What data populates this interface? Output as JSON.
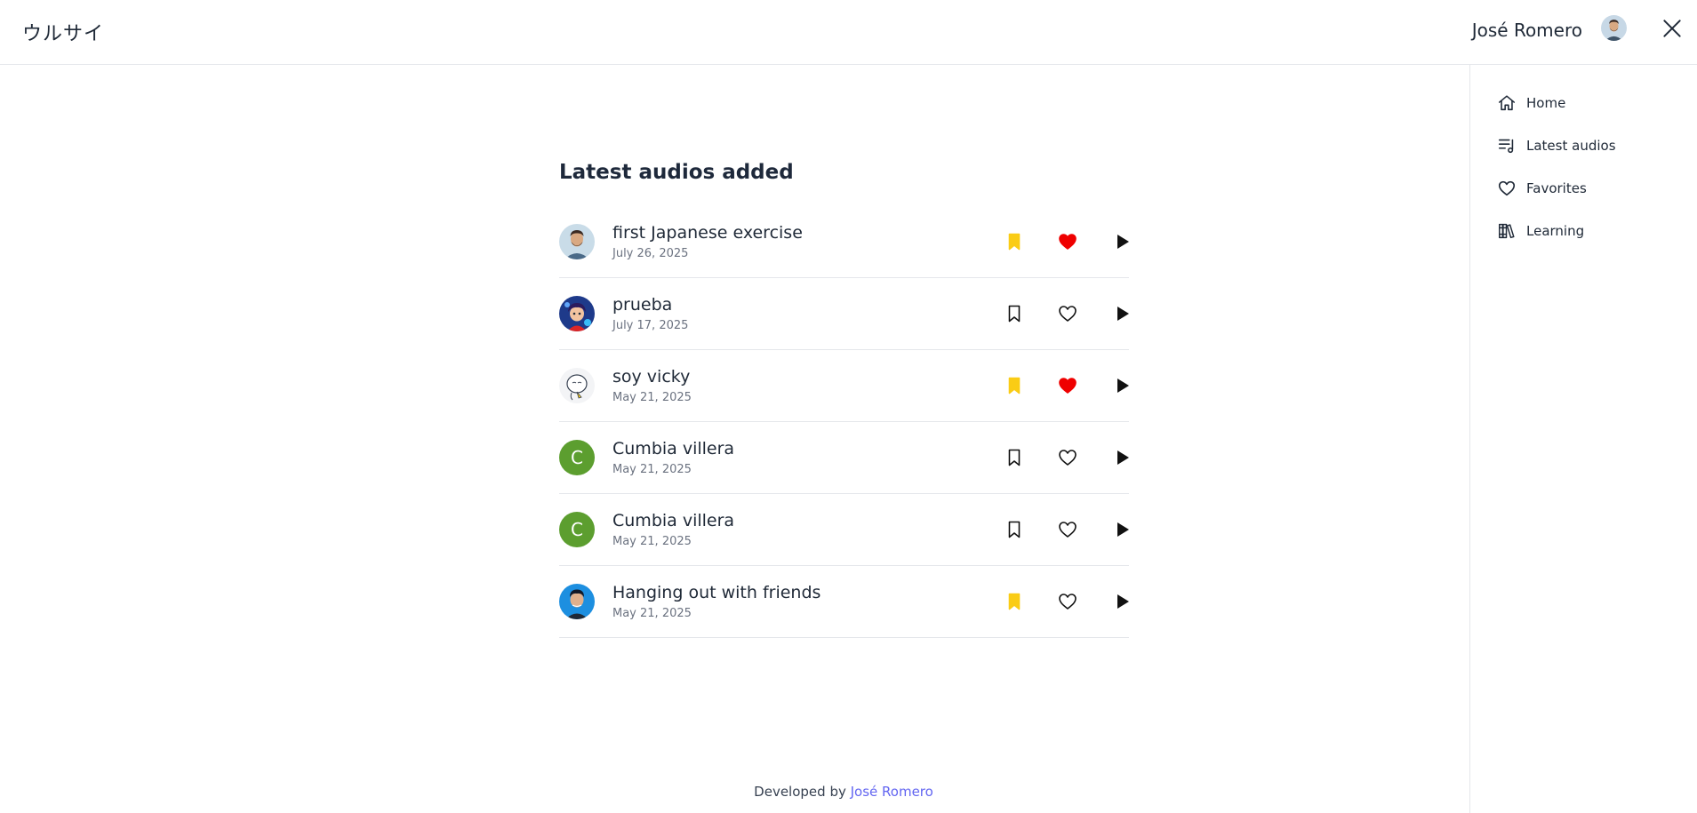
{
  "header": {
    "logo": "ウルサイ",
    "user_name": "José Romero",
    "avatar_icon": "user-avatar-photo",
    "close_icon": "close-icon"
  },
  "sidebar": {
    "items": [
      {
        "label": "Home",
        "icon": "home-icon"
      },
      {
        "label": "Latest audios",
        "icon": "playlist-music-icon"
      },
      {
        "label": "Favorites",
        "icon": "heart-icon"
      },
      {
        "label": "Learning",
        "icon": "books-icon"
      }
    ]
  },
  "main": {
    "title": "Latest audios added",
    "audios": [
      {
        "title": "first Japanese exercise",
        "date": "July 26, 2025",
        "avatar": "photo",
        "bookmarked": true,
        "favorite": true
      },
      {
        "title": "prueba",
        "date": "July 17, 2025",
        "avatar": "photo",
        "bookmarked": false,
        "favorite": false
      },
      {
        "title": "soy vicky",
        "date": "May 21, 2025",
        "avatar": "photo",
        "bookmarked": true,
        "favorite": true
      },
      {
        "title": "Cumbia villera",
        "date": "May 21, 2025",
        "avatar": "C",
        "bookmarked": false,
        "favorite": false
      },
      {
        "title": "Cumbia villera",
        "date": "May 21, 2025",
        "avatar": "C",
        "bookmarked": false,
        "favorite": false
      },
      {
        "title": "Hanging out with friends",
        "date": "May 21, 2025",
        "avatar": "photo",
        "bookmarked": true,
        "favorite": false
      }
    ]
  },
  "footer": {
    "prefix": "Developed by",
    "link": "José Romero"
  },
  "colors": {
    "bookmark_active": "#facc15",
    "favorite_active": "#ef0000",
    "letter_avatar_bg": "#5c9e2f",
    "link": "#6366f1",
    "title": "#1e293b"
  }
}
